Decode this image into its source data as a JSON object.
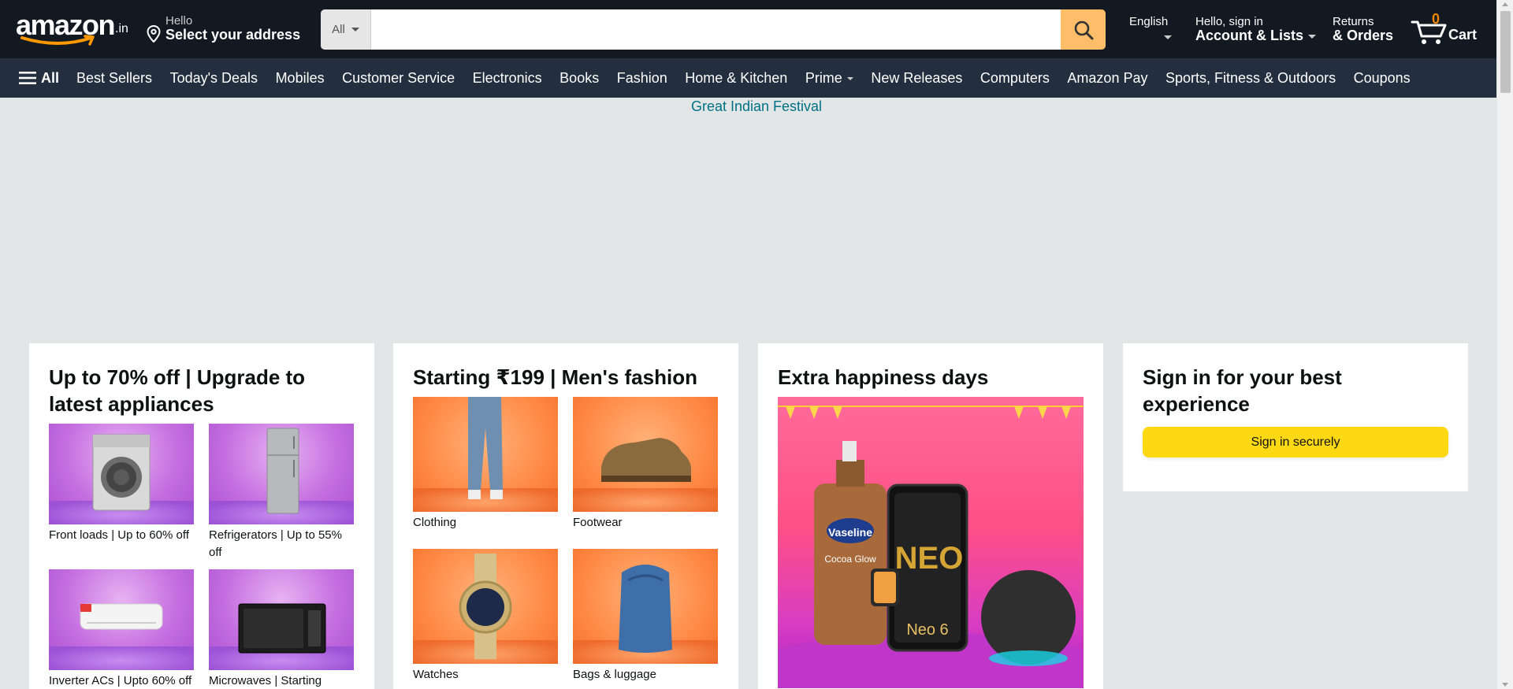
{
  "header": {
    "logo_text": "amazon",
    "logo_tld": ".in",
    "address_greeting": "Hello",
    "address_prompt": "Select your address",
    "search": {
      "category": "All",
      "placeholder": ""
    },
    "language": "English",
    "account_greeting": "Hello, sign in",
    "account_label": "Account & Lists",
    "returns_line1": "Returns",
    "returns_line2": "& Orders",
    "cart_count": "0",
    "cart_label": "Cart"
  },
  "subnav": {
    "all_label": "All",
    "items": [
      "Best Sellers",
      "Today's Deals",
      "Mobiles",
      "Customer Service",
      "Electronics",
      "Books",
      "Fashion",
      "Home & Kitchen",
      "Prime",
      "New Releases",
      "Computers",
      "Amazon Pay",
      "Sports, Fitness & Outdoors",
      "Coupons"
    ]
  },
  "banner": {
    "link_text": "Great Indian Festival"
  },
  "cards": [
    {
      "title": "Up to 70% off | Upgrade to latest appliances",
      "tiles": [
        {
          "caption": "Front loads | Up to 60% off",
          "icon": "washing-machine"
        },
        {
          "caption": "Refrigerators | Up to 55% off",
          "icon": "refrigerator"
        },
        {
          "caption": "Inverter ACs | Upto 60% off",
          "icon": "air-conditioner"
        },
        {
          "caption": "Microwaves | Starting",
          "icon": "microwave"
        }
      ]
    },
    {
      "title": "Starting ₹199 | Men's fashion",
      "tiles": [
        {
          "caption": "Clothing",
          "icon": "jeans"
        },
        {
          "caption": "Footwear",
          "icon": "shoe"
        },
        {
          "caption": "Watches",
          "icon": "watch"
        },
        {
          "caption": "Bags & luggage",
          "icon": "backpack"
        }
      ]
    },
    {
      "title": "Extra happiness days",
      "hero_icon": "products-collage",
      "hero_texts": {
        "vaseline_brand": "Vaseline",
        "vaseline_product": "Cocoa Glow",
        "phone_model": "Neo 6"
      }
    }
  ],
  "signin": {
    "title": "Sign in for your best experience",
    "button": "Sign in securely"
  },
  "colors": {
    "nav_bg": "#131921",
    "subnav_bg": "#232f3e",
    "search_button": "#febd69",
    "cart_count": "#f08804",
    "signin_button": "#ffd814",
    "link": "#007185",
    "page_bg": "#e3e6e6"
  }
}
